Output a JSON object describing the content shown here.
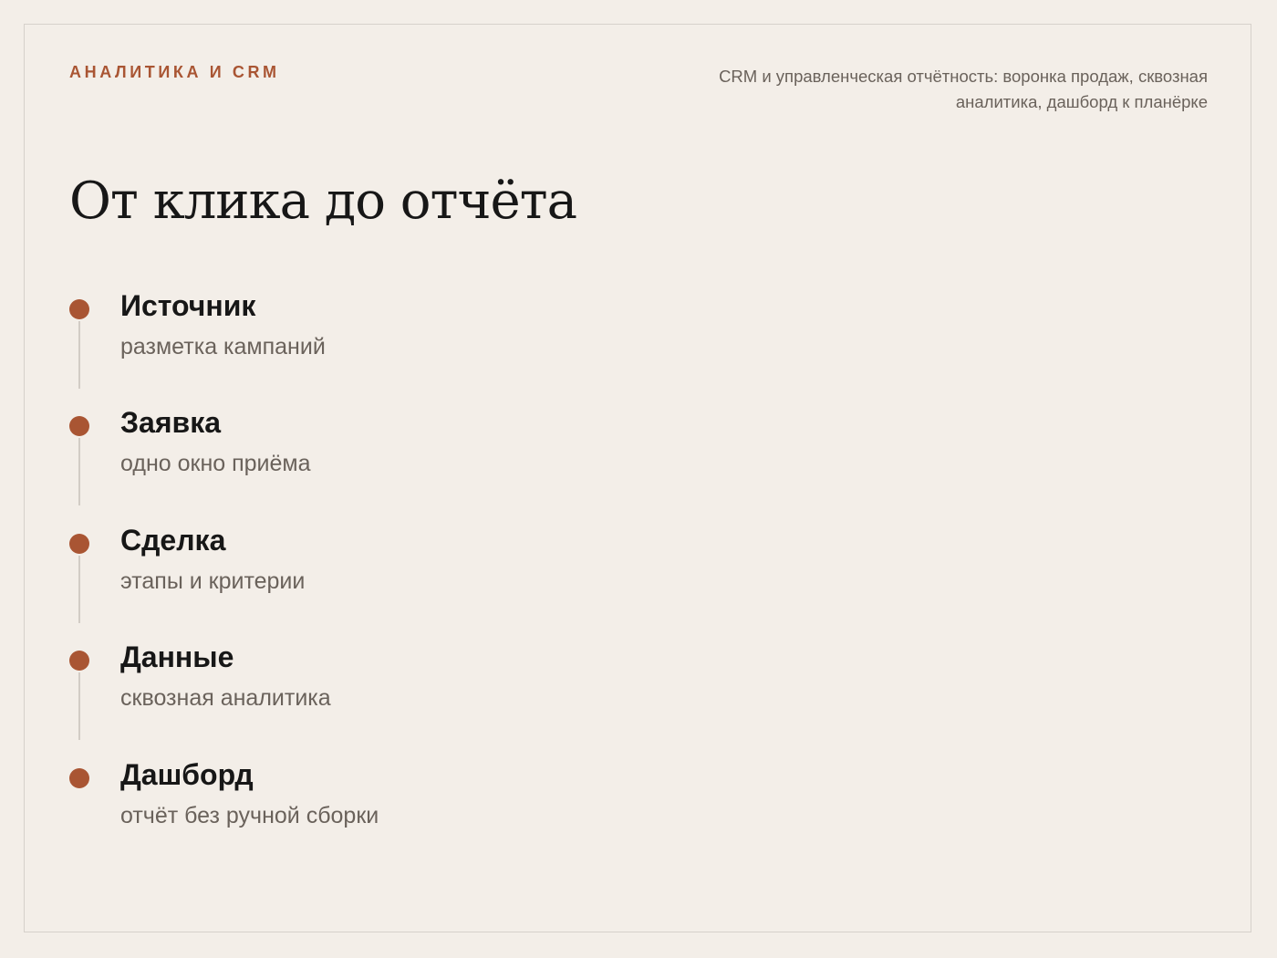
{
  "header": {
    "kicker": "АНАЛИТИКА И CRM",
    "subtitle": "CRM и управленческая отчётность: воронка продаж, сквозная аналитика, дашборд к планёрке"
  },
  "title": "От клика до отчёта",
  "colors": {
    "accent": "#a95533",
    "background": "#f3eee8",
    "text": "#171717",
    "muted": "#6a625b"
  },
  "steps": [
    {
      "title": "Источник",
      "description": "разметка кампаний"
    },
    {
      "title": "Заявка",
      "description": "одно окно приёма"
    },
    {
      "title": "Сделка",
      "description": "этапы и критерии"
    },
    {
      "title": "Данные",
      "description": "сквозная аналитика"
    },
    {
      "title": "Дашборд",
      "description": "отчёт без ручной сборки"
    }
  ]
}
